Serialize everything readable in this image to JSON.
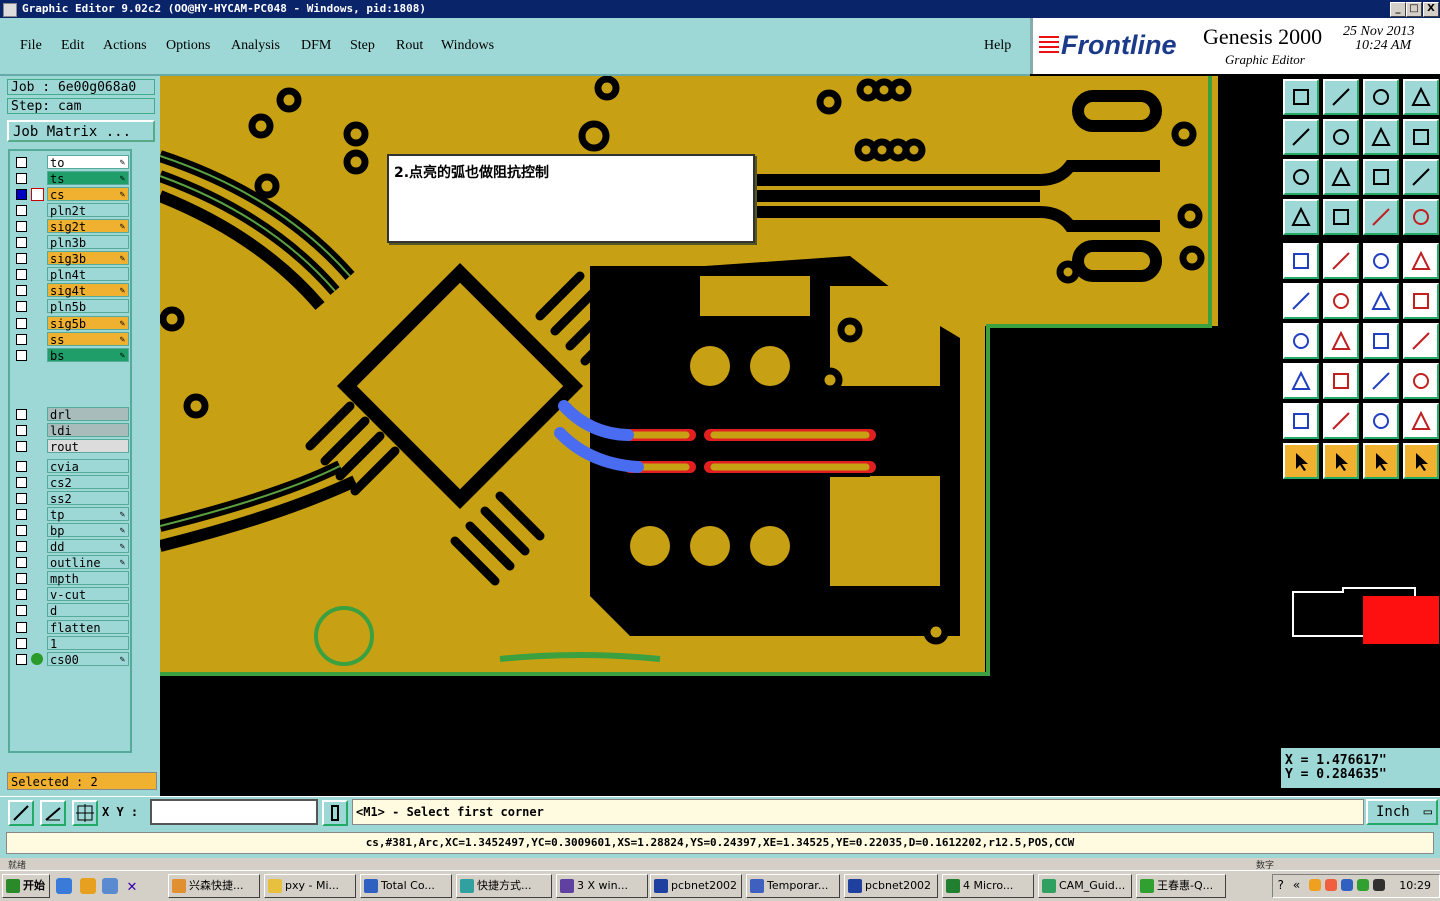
{
  "window": {
    "title": "Graphic Editor 9.02c2 (OO@HY-HYCAM-PC048 - Windows, pid:1808)",
    "min": "_",
    "max": "□",
    "close": "X"
  },
  "menu": {
    "file": "File",
    "edit": "Edit",
    "actions": "Actions",
    "options": "Options",
    "analysis": "Analysis",
    "dfm": "DFM",
    "step": "Step",
    "rout": "Rout",
    "windows": "Windows",
    "help": "Help"
  },
  "brand": {
    "company": "Frontline",
    "product": "Genesis 2000",
    "module": "Graphic Editor",
    "date": "25 Nov 2013",
    "time": "10:24 AM"
  },
  "job": {
    "job_line": "Job : 6e00g068a0",
    "step_line": "Step: cam",
    "matrix_button": "Job Matrix ..."
  },
  "layers": [
    {
      "name": "to",
      "color": "#ffffff",
      "pen": true
    },
    {
      "name": "ts",
      "color": "#1f9e6a",
      "pen": true
    },
    {
      "name": "cs",
      "color": "#f0b030",
      "pen": true,
      "active": true
    },
    {
      "name": "pln2t",
      "color": "#9ed8d6",
      "pen": false
    },
    {
      "name": "sig2t",
      "color": "#f0b030",
      "pen": true
    },
    {
      "name": "pln3b",
      "color": "#9ed8d6",
      "pen": false
    },
    {
      "name": "sig3b",
      "color": "#f0b030",
      "pen": true
    },
    {
      "name": "pln4t",
      "color": "#9ed8d6",
      "pen": false
    },
    {
      "name": "sig4t",
      "color": "#f0b030",
      "pen": true
    },
    {
      "name": "pln5b",
      "color": "#9ed8d6",
      "pen": false
    },
    {
      "name": "sig5b",
      "color": "#f0b030",
      "pen": true
    },
    {
      "name": "ss",
      "color": "#f0b030",
      "pen": true
    },
    {
      "name": "bs",
      "color": "#1f9e6a",
      "pen": true
    },
    {
      "name": "drl",
      "color": "#a9bcbc",
      "pen": false
    },
    {
      "name": "ldi",
      "color": "#a9bcbc",
      "pen": false
    },
    {
      "name": "rout",
      "color": "#dcdcdc",
      "pen": false
    },
    {
      "name": "cvia",
      "color": "#9ed8d6",
      "pen": false
    },
    {
      "name": "cs2",
      "color": "#9ed8d6",
      "pen": false
    },
    {
      "name": "ss2",
      "color": "#9ed8d6",
      "pen": false
    },
    {
      "name": "tp",
      "color": "#9ed8d6",
      "pen": true
    },
    {
      "name": "bp",
      "color": "#9ed8d6",
      "pen": true
    },
    {
      "name": "dd",
      "color": "#9ed8d6",
      "pen": true
    },
    {
      "name": "outline",
      "color": "#9ed8d6",
      "pen": true
    },
    {
      "name": "mpth",
      "color": "#9ed8d6",
      "pen": false
    },
    {
      "name": "v-cut",
      "color": "#9ed8d6",
      "pen": false
    },
    {
      "name": "d",
      "color": "#9ed8d6",
      "pen": false
    },
    {
      "name": "flatten",
      "color": "#9ed8d6",
      "pen": false
    },
    {
      "name": "1",
      "color": "#9ed8d6",
      "pen": false
    },
    {
      "name": "cs00",
      "color": "#9ed8d6",
      "pen": true
    }
  ],
  "selected_text": "Selected : 2",
  "popup_note": "2.点亮的弧也做阻抗控制",
  "coords": {
    "x": "X = 1.476617\"",
    "y": "Y = 0.284635\""
  },
  "command": {
    "xy_label": "X Y :",
    "xy_value": "",
    "prompt": "<M1> - Select first corner",
    "units": "Inch"
  },
  "info_line": "cs,#381,Arc,XC=1.3452497,YC=0.3009601,XS=1.28824,YS=0.24397,XE=1.34525,YE=0.22035,D=0.1612202,r12.5,POS,CCW",
  "strip": {
    "left": "就绪",
    "right": "数字"
  },
  "taskbar": {
    "start": "开始",
    "tasks": [
      "兴森快捷...",
      "pxy - Mi...",
      "Total Co...",
      "快捷方式...",
      "3 X win...",
      "pcbnet2002",
      "Temporar...",
      "pcbnet2002",
      "4 Micro...",
      "CAM_Guid...",
      "王春惠-Q..."
    ],
    "clock": "10:29"
  },
  "colors": {
    "copper": "#c8a014",
    "laminate": "#000000",
    "highlight": "#4a6cf0",
    "outline": "#3aa040",
    "ui_teal": "#9ed8d6",
    "accent_orange": "#f0b030"
  }
}
